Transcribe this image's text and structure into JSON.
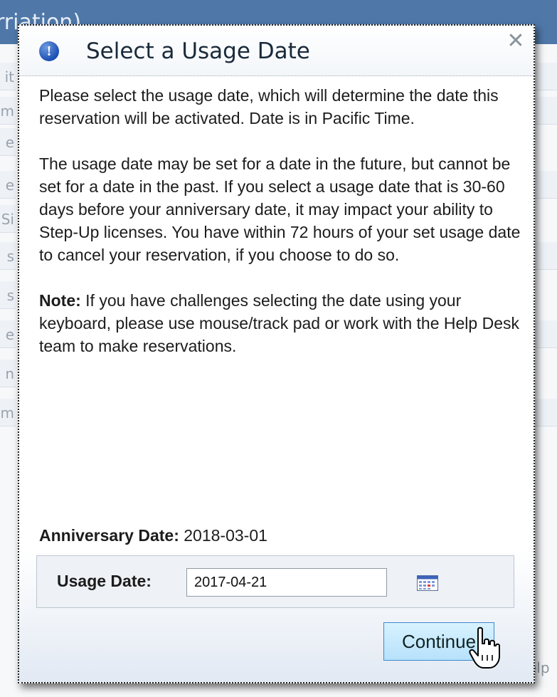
{
  "background": {
    "header_text": "rriation)",
    "left_letters": [
      "it",
      "m",
      "e",
      "e",
      "Si",
      "s",
      "s",
      "e",
      "n",
      "m"
    ],
    "footer_text": "elp"
  },
  "dialog": {
    "title": "Select a Usage Date",
    "info_glyph": "!",
    "close_glyph": "✕",
    "paragraph1": "Please select the usage date, which will determine the date this reservation will be activated. Date is in Pacific Time.",
    "paragraph2": "The usage date may be set for a date in the future, but cannot be set for a date in the past. If you select a usage date that is 30-60 days before your anniversary date, it may impact your ability to Step-Up licenses. You have within 72 hours of your set usage date to cancel your reservation, if you choose to do so.",
    "note_label": "Note:",
    "note_text": "If you have challenges selecting the date using your keyboard, please use mouse/track pad or work with the Help Desk team to make reservations.",
    "anniversary_label": "Anniversary Date:",
    "anniversary_value": "2018-03-01",
    "usage_label": "Usage Date:",
    "usage_value": "2017-04-21",
    "continue_label": "Continue"
  },
  "colors": {
    "header_blue": "#4f78a8",
    "button_bg": "#c8ebff",
    "info_blue": "#1b4fb3"
  },
  "icons": {
    "info": "info-icon",
    "close": "close-icon",
    "calendar": "calendar-icon",
    "cursor": "hand-cursor-icon"
  }
}
